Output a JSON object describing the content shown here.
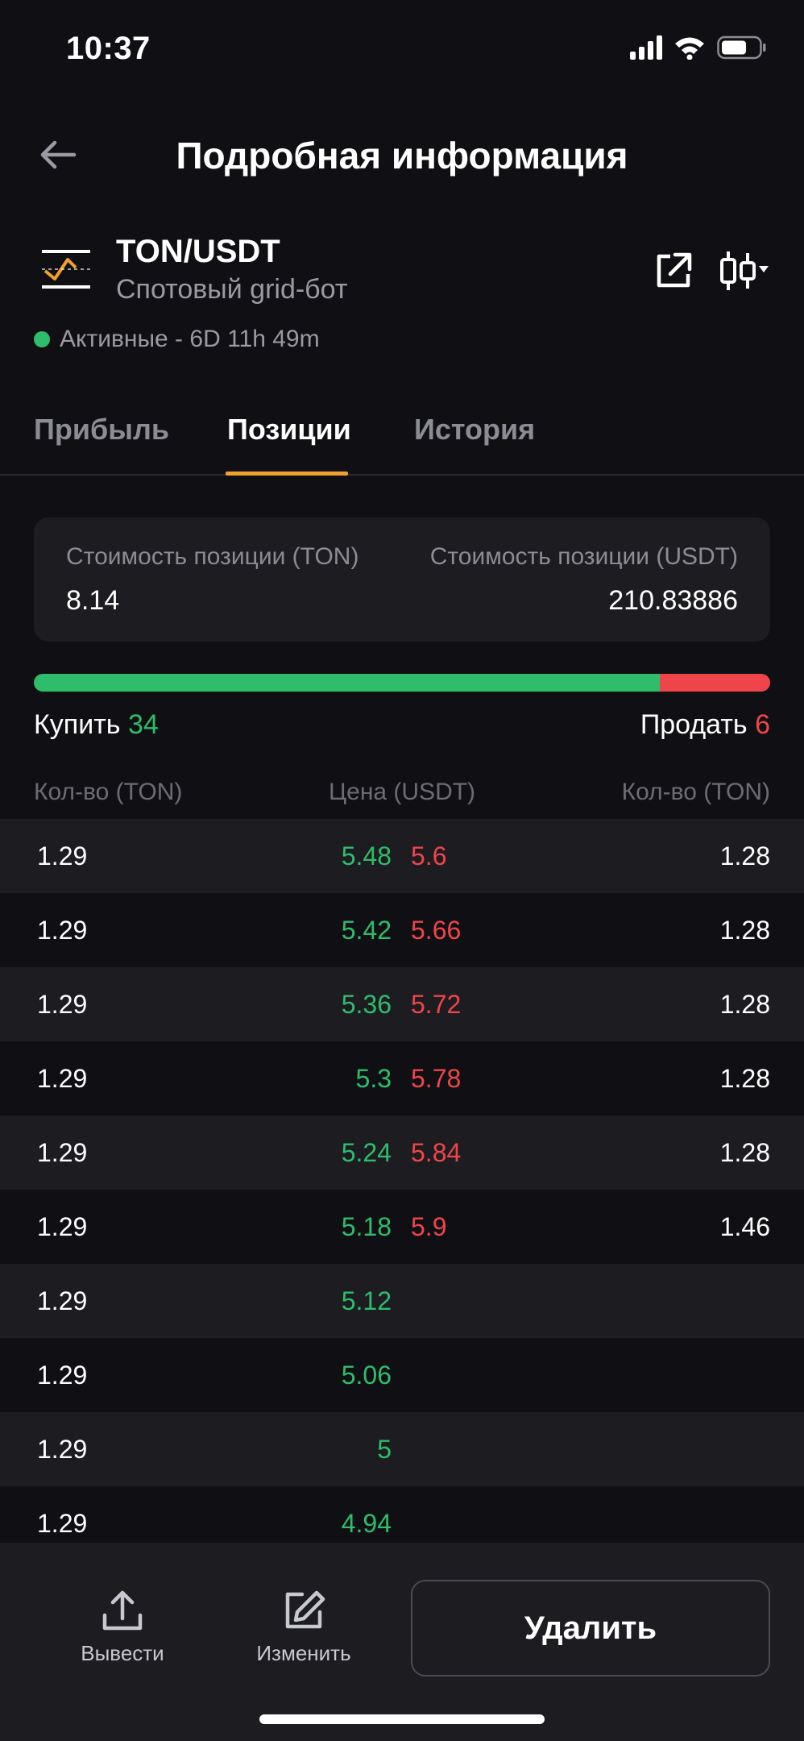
{
  "status_bar": {
    "time": "10:37"
  },
  "header": {
    "title": "Подробная информация"
  },
  "bot": {
    "pair": "TON/USDT",
    "type": "Спотовый grid-бот",
    "status": "Активные - 6D 11h 49m",
    "status_color": "#2ebd6b"
  },
  "tabs": [
    {
      "label": "Прибыль",
      "active": false
    },
    {
      "label": "Позиции",
      "active": true
    },
    {
      "label": "История",
      "active": false
    }
  ],
  "summary": {
    "left_label": "Стоимость позиции (TON)",
    "left_value": "8.14",
    "right_label": "Стоимость позиции (USDT)",
    "right_value": "210.83886"
  },
  "ratio": {
    "buy_count": 34,
    "sell_count": 6,
    "buy_fraction": 0.85
  },
  "orders_summary": {
    "buy_label": "Купить",
    "buy_count": "34",
    "sell_label": "Продать",
    "sell_count": "6"
  },
  "columns": {
    "left": "Кол-во (TON)",
    "mid": "Цена (USDT)",
    "right": "Кол-во (TON)"
  },
  "rows": [
    {
      "buy_qty": "1.29",
      "buy_price": "5.48",
      "sell_price": "5.6",
      "sell_qty": "1.28"
    },
    {
      "buy_qty": "1.29",
      "buy_price": "5.42",
      "sell_price": "5.66",
      "sell_qty": "1.28"
    },
    {
      "buy_qty": "1.29",
      "buy_price": "5.36",
      "sell_price": "5.72",
      "sell_qty": "1.28"
    },
    {
      "buy_qty": "1.29",
      "buy_price": "5.3",
      "sell_price": "5.78",
      "sell_qty": "1.28"
    },
    {
      "buy_qty": "1.29",
      "buy_price": "5.24",
      "sell_price": "5.84",
      "sell_qty": "1.28"
    },
    {
      "buy_qty": "1.29",
      "buy_price": "5.18",
      "sell_price": "5.9",
      "sell_qty": "1.46"
    },
    {
      "buy_qty": "1.29",
      "buy_price": "5.12",
      "sell_price": "",
      "sell_qty": ""
    },
    {
      "buy_qty": "1.29",
      "buy_price": "5.06",
      "sell_price": "",
      "sell_qty": ""
    },
    {
      "buy_qty": "1.29",
      "buy_price": "5",
      "sell_price": "",
      "sell_qty": ""
    },
    {
      "buy_qty": "1.29",
      "buy_price": "4.94",
      "sell_price": "",
      "sell_qty": ""
    }
  ],
  "bottom": {
    "withdraw_label": "Вывести",
    "edit_label": "Изменить",
    "delete_label": "Удалить"
  },
  "colors": {
    "accent": "#f0a12b",
    "buy": "#2ebd6b",
    "sell": "#ef454a",
    "background": "#101014"
  }
}
